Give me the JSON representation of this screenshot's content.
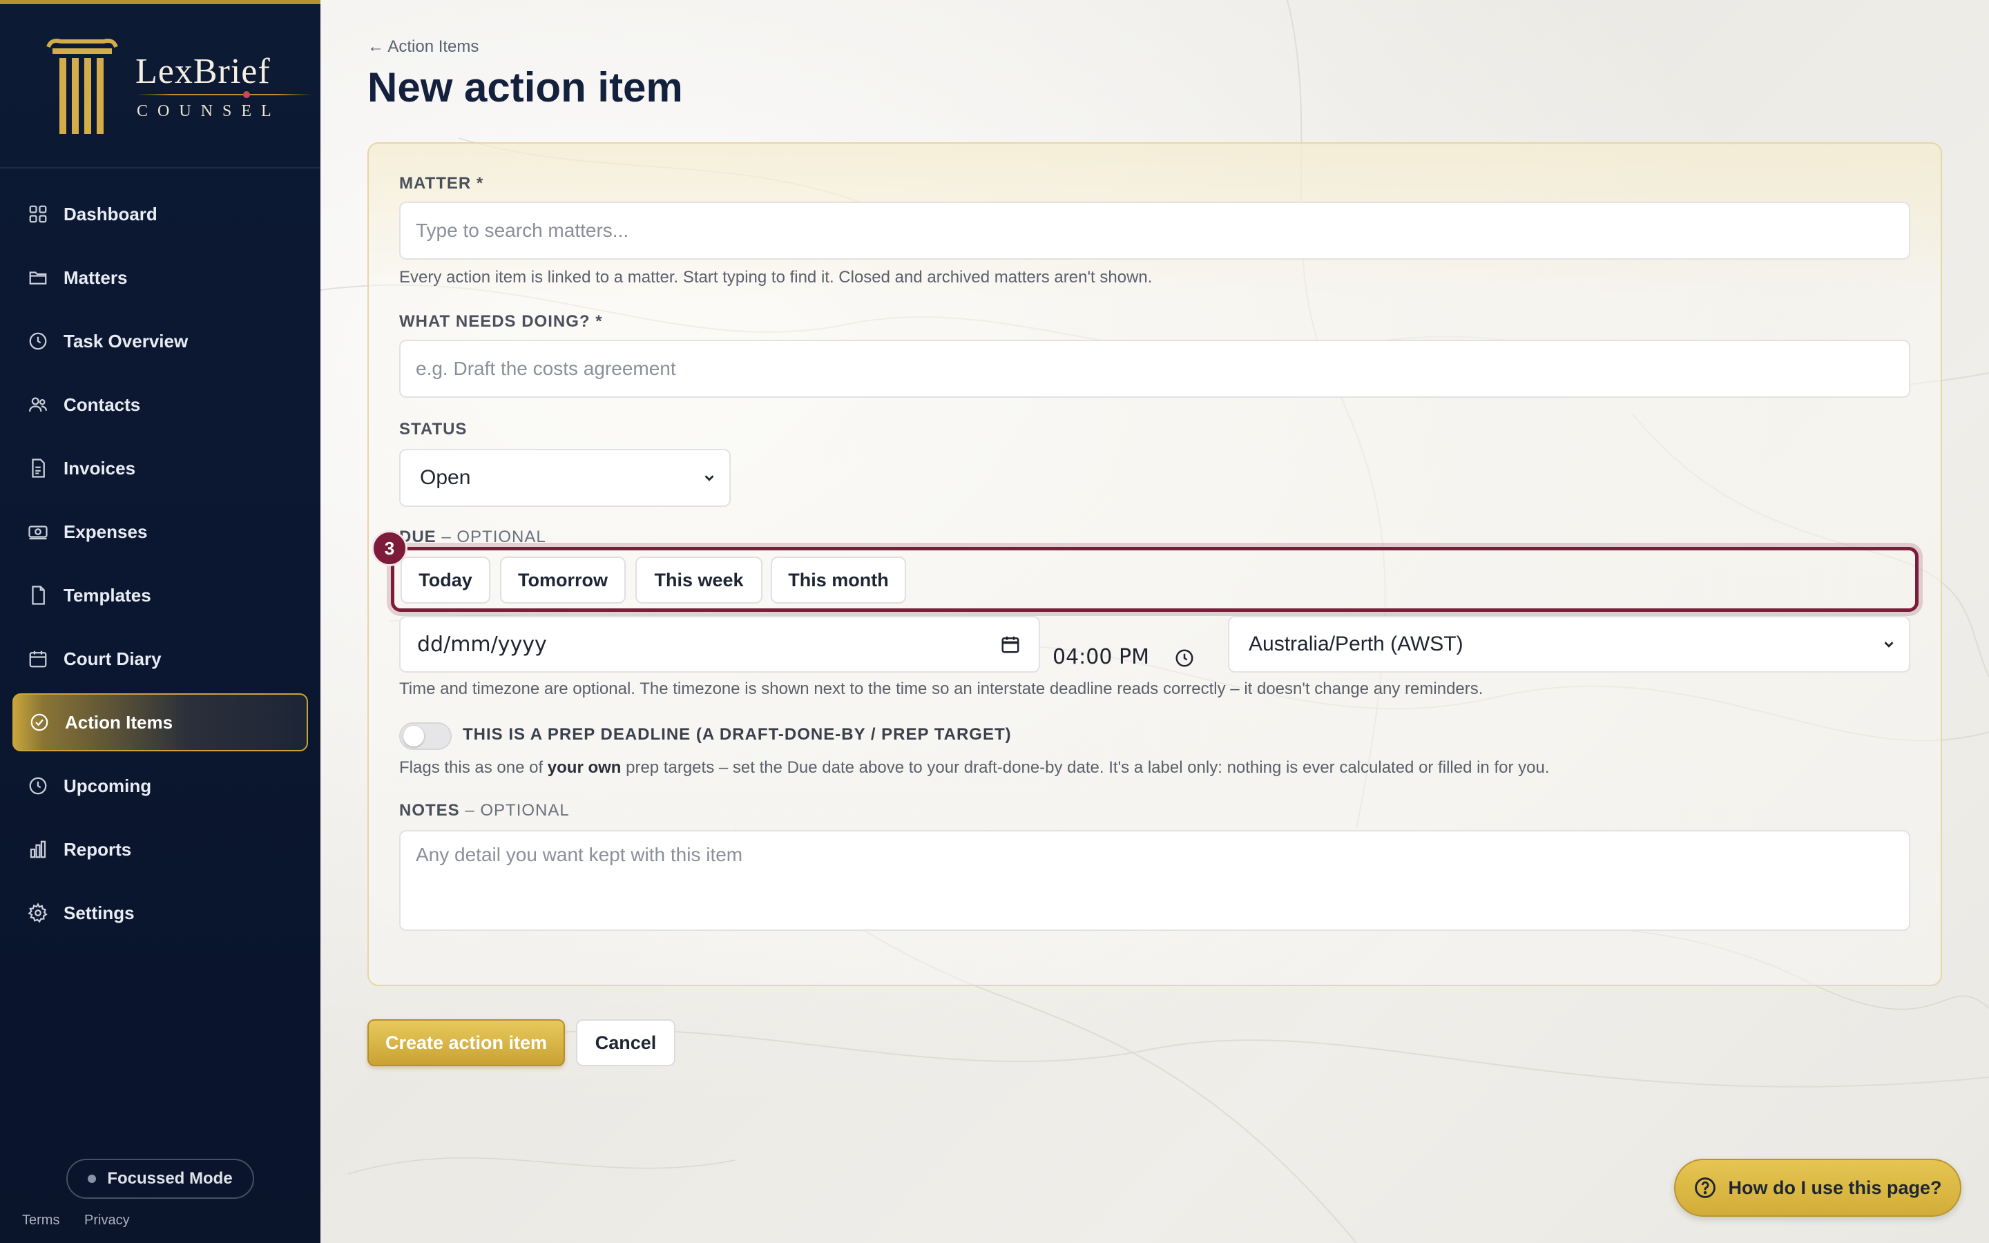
{
  "brand": {
    "name": "LexBrief",
    "sub": "COUNSEL"
  },
  "sidebar": {
    "items": [
      {
        "label": "Dashboard",
        "icon": "dashboard-grid-icon"
      },
      {
        "label": "Matters",
        "icon": "folder-icon"
      },
      {
        "label": "Task Overview",
        "icon": "clock-icon"
      },
      {
        "label": "Contacts",
        "icon": "users-icon"
      },
      {
        "label": "Invoices",
        "icon": "invoice-icon"
      },
      {
        "label": "Expenses",
        "icon": "banknote-icon"
      },
      {
        "label": "Templates",
        "icon": "document-icon"
      },
      {
        "label": "Court Diary",
        "icon": "calendar-icon"
      },
      {
        "label": "Action Items",
        "icon": "check-circle-icon",
        "active": true
      },
      {
        "label": "Upcoming",
        "icon": "clock-icon"
      },
      {
        "label": "Reports",
        "icon": "bar-chart-icon"
      },
      {
        "label": "Settings",
        "icon": "gear-icon"
      }
    ],
    "focus_mode": "Focussed Mode",
    "footer": {
      "terms": "Terms",
      "privacy": "Privacy"
    }
  },
  "header": {
    "breadcrumb": "← Action Items",
    "title": "New action item"
  },
  "form": {
    "matter": {
      "label": "MATTER *",
      "placeholder": "Type to search matters...",
      "help": "Every action item is linked to a matter. Start typing to find it. Closed and archived matters aren't shown."
    },
    "task": {
      "label": "WHAT NEEDS DOING? *",
      "placeholder": "e.g. Draft the costs agreement"
    },
    "status": {
      "label": "STATUS",
      "value": "Open"
    },
    "due": {
      "label": "DUE",
      "optional": "– OPTIONAL",
      "quick": [
        "Today",
        "Tomorrow",
        "This week",
        "This month"
      ],
      "badge": "3",
      "date_placeholder": "dd/mm/yyyy",
      "time": "04:00 PM",
      "timezone": "Australia/Perth (AWST)",
      "help": "Time and timezone are optional. The timezone is shown next to the time so an interstate deadline reads correctly – it doesn't change any reminders."
    },
    "prep": {
      "label": "THIS IS A PREP DEADLINE (A DRAFT-DONE-BY / PREP TARGET)",
      "help_pre": "Flags this as one of ",
      "help_bold": "your own",
      "help_post": " prep targets – set the Due date above to your draft-done-by date. It's a label only: nothing is ever calculated or filled in for you."
    },
    "notes": {
      "label": "NOTES",
      "optional": "– OPTIONAL",
      "placeholder": "Any detail you want kept with this item"
    }
  },
  "actions": {
    "create": "Create action item",
    "cancel": "Cancel"
  },
  "help_button": "How do I use this page?",
  "colors": {
    "accent_gold": "#c9a233",
    "highlight": "#7c1c3a",
    "sidebar_bg": "#0d1a33"
  }
}
